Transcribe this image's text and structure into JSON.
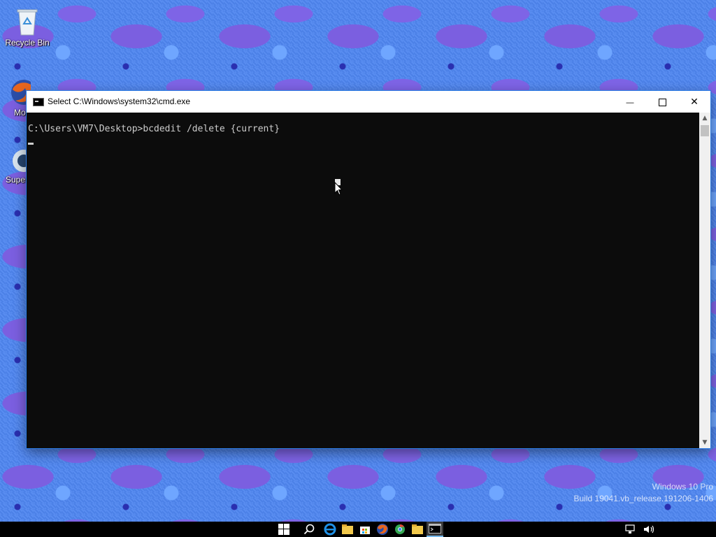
{
  "desktop": {
    "icons": [
      {
        "label": "Recycle Bin"
      },
      {
        "label": "Mozilla Firefox"
      },
      {
        "label": "Super"
      }
    ],
    "watermark": {
      "line1": "Windows 10 Pro",
      "line2": "Build 19041.vb_release.191206-1406"
    }
  },
  "cmd_window": {
    "title": "Select C:\\Windows\\system32\\cmd.exe",
    "console_text": "C:\\Users\\VM7\\Desktop>bcdedit /delete {current}",
    "controls": {
      "minimize": "—",
      "close": "✕"
    }
  },
  "taskbar": {
    "items": [
      "start",
      "search",
      "internet-explorer",
      "file-explorer",
      "store",
      "firefox",
      "chrome",
      "folder",
      "command-prompt"
    ],
    "active": "command-prompt"
  },
  "colors": {
    "console_bg": "#0c0c0c",
    "console_fg": "#cccccc",
    "desktop_bg": "#4f86f0",
    "taskbar_bg": "#000000"
  }
}
